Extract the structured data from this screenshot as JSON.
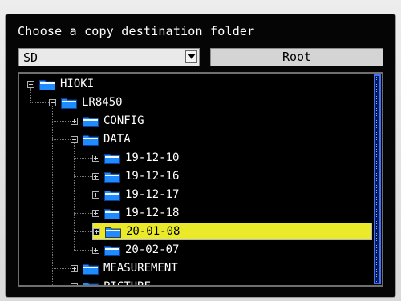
{
  "dialog": {
    "title": "Choose a copy destination folder",
    "drive": {
      "selected": "SD"
    },
    "root_button_label": "Root"
  },
  "tree": [
    {
      "label": "HIOKI",
      "expander": "minus",
      "icon": "folder-icon",
      "selected": false
    },
    {
      "label": "LR8450",
      "expander": "minus",
      "icon": "folder-icon",
      "selected": false
    },
    {
      "label": "CONFIG",
      "expander": "plus",
      "icon": "folder-icon",
      "selected": false
    },
    {
      "label": "DATA",
      "expander": "minus",
      "icon": "folder-icon",
      "selected": false
    },
    {
      "label": "19-12-10",
      "expander": "plus",
      "icon": "folder-icon",
      "selected": false
    },
    {
      "label": "19-12-16",
      "expander": "plus",
      "icon": "folder-icon",
      "selected": false
    },
    {
      "label": "19-12-17",
      "expander": "plus",
      "icon": "folder-icon",
      "selected": false
    },
    {
      "label": "19-12-18",
      "expander": "plus",
      "icon": "folder-icon",
      "selected": false
    },
    {
      "label": "20-01-08",
      "expander": "plus",
      "icon": "folder-icon",
      "selected": true
    },
    {
      "label": "20-02-07",
      "expander": "plus",
      "icon": "folder-icon",
      "selected": false
    },
    {
      "label": "MEASUREMENT",
      "expander": "plus",
      "icon": "folder-icon",
      "selected": false
    },
    {
      "label": "PICTURE",
      "expander": "plus",
      "icon": "folder-icon",
      "selected": false
    }
  ],
  "colors": {
    "selection": "#eaea2a",
    "folder": "#1e8cff",
    "scrollbar": "#3f73ff",
    "background": "#000000"
  }
}
